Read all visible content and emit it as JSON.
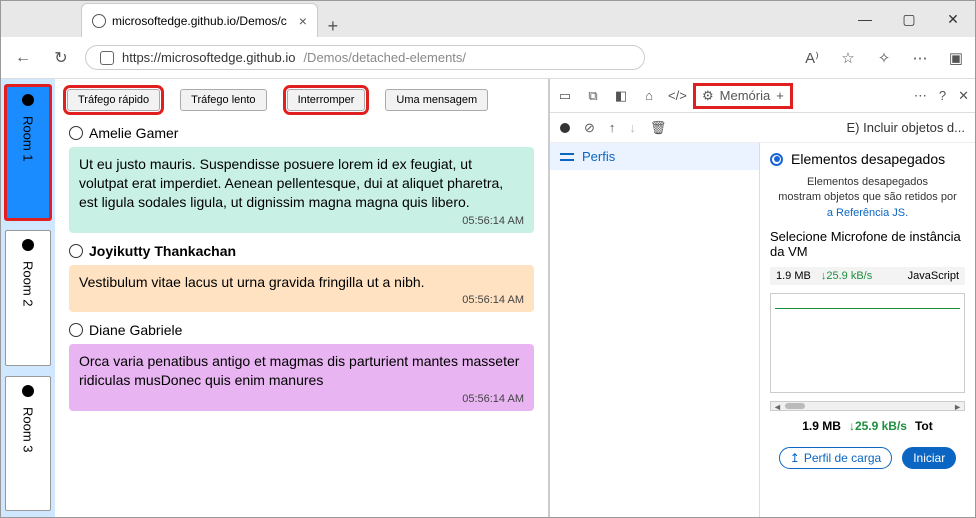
{
  "browser": {
    "tab_title": "microsoftedge.github.io/Demos/c",
    "url_host": "https://microsoftedge.github.io",
    "url_path": "/Demos/detached-elements/",
    "win_min": "—",
    "win_max": "▢",
    "win_close": "✕"
  },
  "rooms": [
    {
      "label": "Room 1",
      "active": true
    },
    {
      "label": "Room 2",
      "active": false
    },
    {
      "label": "Room 3",
      "active": false
    }
  ],
  "toolbar": {
    "fast": "Tráfego rápido",
    "slow": "Tráfego lento",
    "interrupt": "Interromper",
    "one": "Uma mensagem"
  },
  "messages": [
    {
      "author": "Amelie Gamer",
      "bold": false,
      "text": "Ut eu justo mauris. Suspendisse posuere lorem id ex feugiat, ut volutpat erat imperdiet. Aenean pellentesque, dui at aliquet pharetra, est ligula sodales ligula, ut dignissim magna magna quis libero.",
      "ts": "05:56:14 AM",
      "cls": "b1"
    },
    {
      "author": "Joyikutty Thankachan",
      "bold": true,
      "text": "Vestibulum vitae lacus ut urna gravida fringilla ut a nibh.",
      "ts": "05:56:14 AM",
      "cls": "b2"
    },
    {
      "author": "Diane Gabriele",
      "bold": false,
      "text": "Orca varia penatibus antigo et magmas dis parturient mantes masseter ridiculas musDonec quis enim manures",
      "ts": "05:56:14 AM",
      "cls": "b3"
    }
  ],
  "devtools": {
    "tab_memory": "Memória",
    "opt_e": "E)  Incluir objetos d...",
    "perfis": "Perfis",
    "radio_label": "Elementos desapegados",
    "desc1": "Elementos desapegados",
    "desc2": "mostram objetos que são retidos por",
    "desc3": "a Referência JS.",
    "select_label": "Selecione Microfone de instância da VM",
    "mb": "1.9 MB",
    "rate": "25.9 kB/s",
    "js": "JavaScript",
    "mb2": "1.9 MB",
    "rate2": "25.9 kB/s",
    "tot": "Tot",
    "btn_load": "Perfil de carga",
    "btn_start": "Iniciar"
  }
}
